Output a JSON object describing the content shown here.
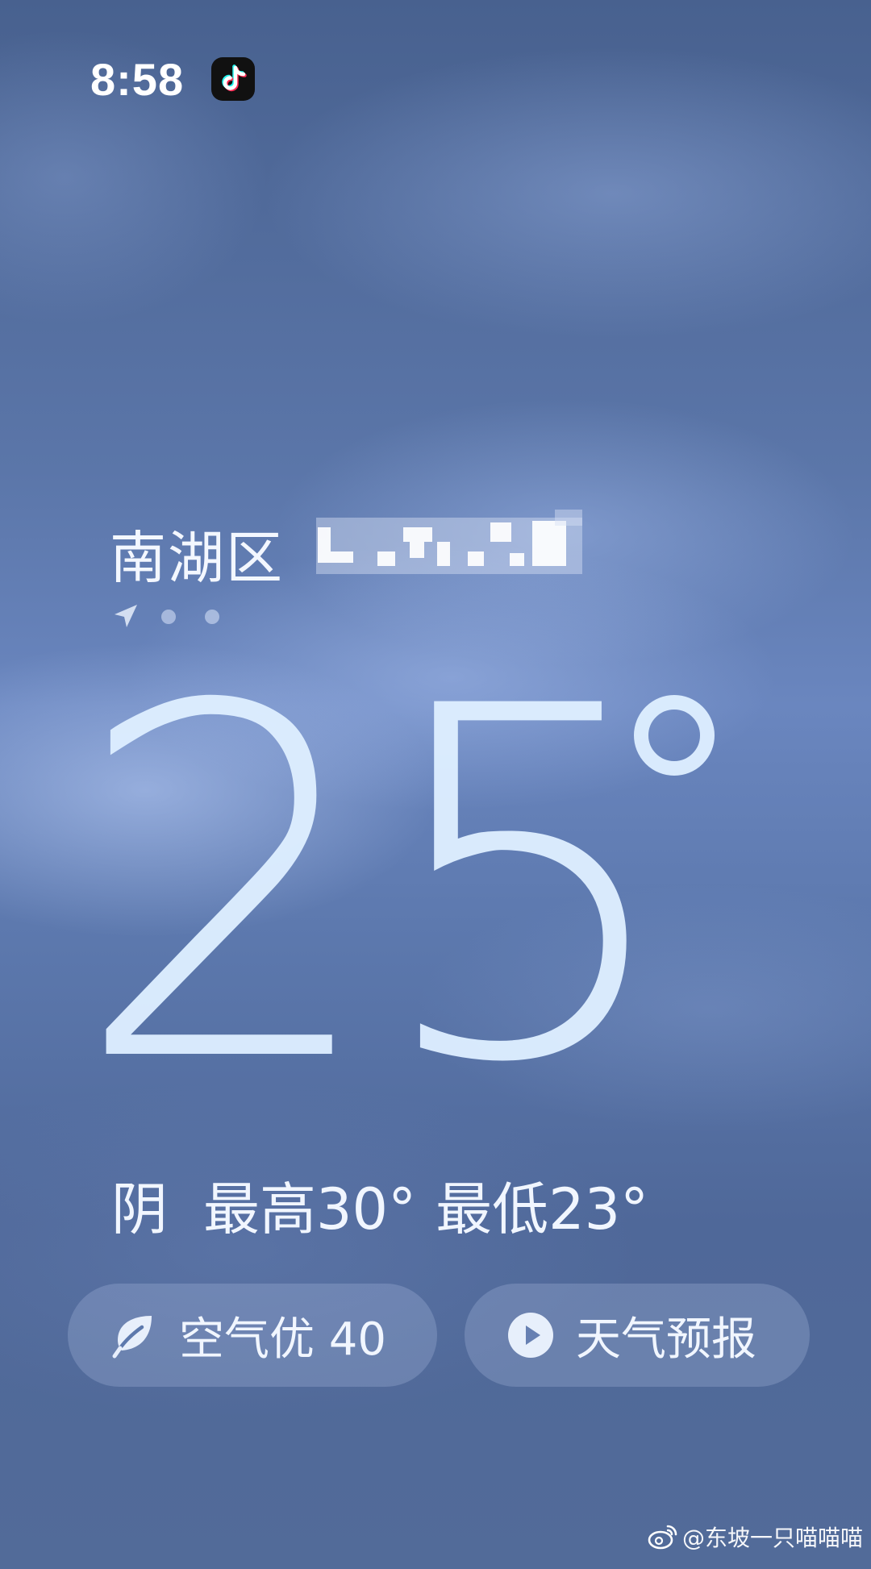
{
  "status_bar": {
    "time": "8:58",
    "app_icon": "tiktok-icon"
  },
  "location": {
    "district": "南湖区",
    "detail_obscured": true
  },
  "page_indicator": {
    "icons": [
      "navigation-arrow-icon",
      "dot",
      "dot"
    ]
  },
  "temperature": {
    "value": "25",
    "unit": "°"
  },
  "condition": {
    "text": "阴",
    "high": "最高30°",
    "low": "最低23°"
  },
  "actions": {
    "air_quality_label": "空气优 40",
    "air_quality_icon": "leaf-icon",
    "forecast_label": "天气预报",
    "forecast_icon": "play-icon"
  },
  "watermark": {
    "text": "@东坡一只喵喵喵",
    "icon": "weibo-icon"
  },
  "colors": {
    "background_top": "#48618f",
    "background_mid": "#6a86bf",
    "background_bottom": "#526b99",
    "temperature_text": "#deeeff"
  }
}
